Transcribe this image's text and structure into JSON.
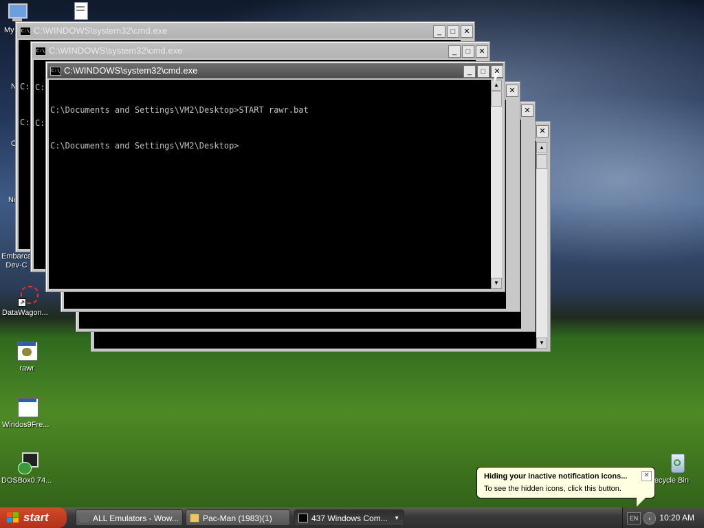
{
  "desktop": {
    "icons": [
      {
        "label": "My",
        "icon": "computer-icon"
      },
      {
        "label": "N",
        "icon": "folder-icon"
      },
      {
        "label": "C",
        "icon": "folder-icon"
      },
      {
        "label": "No",
        "icon": "folder-icon"
      },
      {
        "label": "Embarca Dev-C",
        "icon": "program-icon"
      },
      {
        "label": "DataWagon...",
        "icon": "datawagon-icon"
      },
      {
        "label": "rawr",
        "icon": "batch-file-icon"
      },
      {
        "label": "Windos9Fre...",
        "icon": "window-app-icon"
      },
      {
        "label": "DOSBox0.74...",
        "icon": "dosbox-icon"
      },
      {
        "label": "ecycle Bin",
        "icon": "recycle-bin-icon"
      }
    ]
  },
  "windows": {
    "sysicon_text": "C:\\",
    "back1": {
      "title": "C:\\WINDOWS\\system32\\cmd.exe",
      "line1": "C:",
      "line2": "C:"
    },
    "back2": {
      "title": "C:\\WINDOWS\\system32\\cmd.exe",
      "line1": "C:",
      "line2": "C:"
    },
    "front": {
      "title": "C:\\WINDOWS\\system32\\cmd.exe",
      "lines": [
        "C:\\Documents and Settings\\VM2\\Desktop>START rawr.bat",
        "C:\\Documents and Settings\\VM2\\Desktop>"
      ]
    },
    "buttons": {
      "minimize": "_",
      "maximize": "□",
      "close": "✕"
    }
  },
  "taskbar": {
    "start_label": "start",
    "buttons": [
      {
        "label": "ALL Emulators - Wow...",
        "icon": "emulator-icon"
      },
      {
        "label": "Pac-Man (1983)(1)",
        "icon": "folder-icon"
      },
      {
        "label": "437 Windows Com...",
        "icon": "cmd-icon"
      }
    ],
    "tray": {
      "language": "EN",
      "clock": "10:20 AM"
    }
  },
  "balloon": {
    "title": "Hiding your inactive notification icons...",
    "body": "To see the hidden icons, click this button.",
    "close": "✕"
  },
  "colors": {
    "start": "#c43d22",
    "balloon": "#ffffe1",
    "console_bg": "#000000",
    "console_text": "#c0c0c0"
  }
}
